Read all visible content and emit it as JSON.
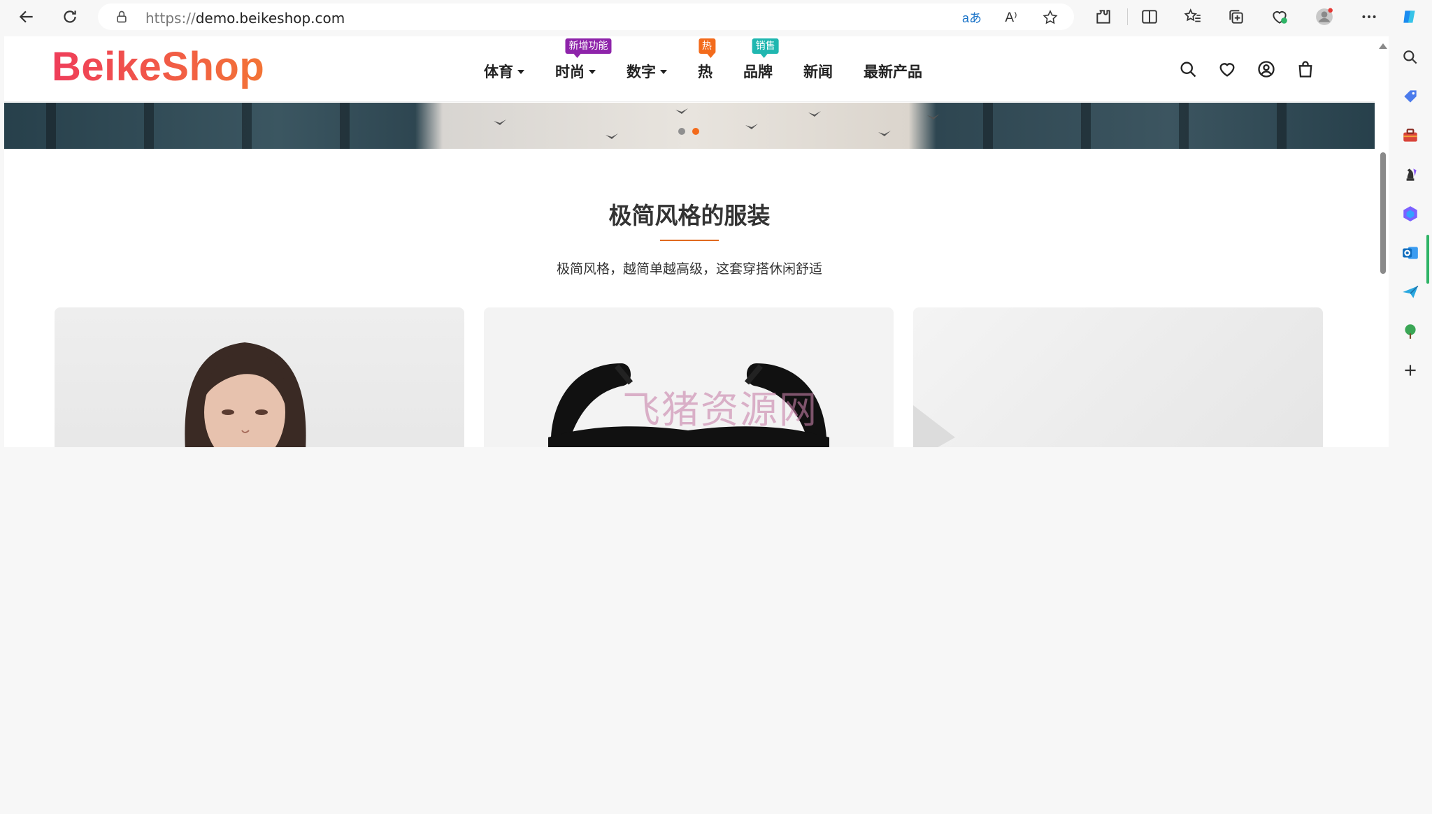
{
  "browser": {
    "url_protocol": "https://",
    "url_host": "demo.beikeshop.com",
    "read_aloud_glyph": "A⁾",
    "translate_glyph": "aあ"
  },
  "site": {
    "logo_text": "BeikeShop",
    "brand_gradient": [
      "#ef3d5a",
      "#f37436"
    ]
  },
  "nav": {
    "items": [
      {
        "label": "体育",
        "has_dropdown": true
      },
      {
        "label": "时尚",
        "has_dropdown": true,
        "badge": "新增功能",
        "badge_color": "#8e24aa"
      },
      {
        "label": "数字",
        "has_dropdown": true
      },
      {
        "label": "热",
        "badge": "热",
        "badge_color": "#f36b1c"
      },
      {
        "label": "品牌",
        "badge": "销售",
        "badge_color": "#20b7b0"
      },
      {
        "label": "新闻"
      },
      {
        "label": "最新产品"
      }
    ]
  },
  "header_icons": [
    "search-icon",
    "heart-icon",
    "user-icon",
    "cart-icon"
  ],
  "carousel": {
    "slide_count": 2,
    "active_index": 1,
    "accent_color": "#f36b1c"
  },
  "section": {
    "title": "极简风格的服装",
    "subtitle": "极简风格，越简单越高级，这套穿搭休闲舒适"
  },
  "watermark": "飞猪资源网"
}
